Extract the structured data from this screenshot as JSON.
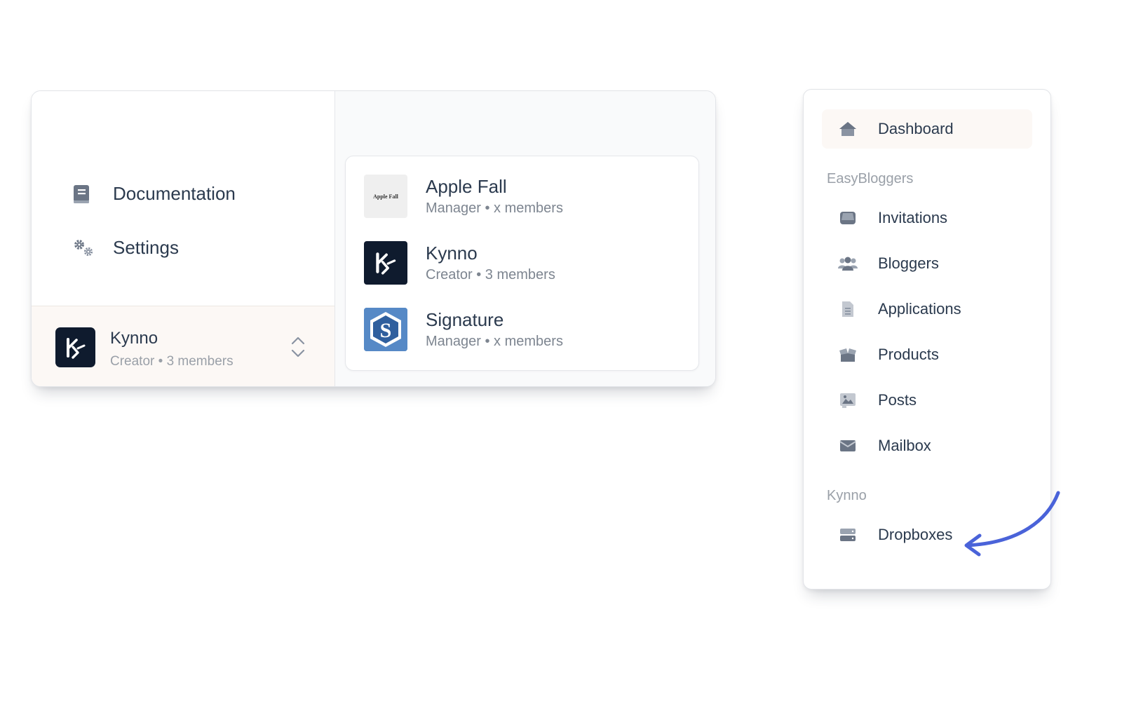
{
  "menu": {
    "documentation_label": "Documentation",
    "settings_label": "Settings"
  },
  "current_workspace": {
    "name": "Kynno",
    "subtitle": "Creator • 3 members"
  },
  "workspaces": [
    {
      "name": "Apple Fall",
      "subtitle": "Manager • x members",
      "logo_text": "Apple Fall"
    },
    {
      "name": "Kynno",
      "subtitle": "Creator • 3 members"
    },
    {
      "name": "Signature",
      "subtitle": "Manager • x members"
    }
  ],
  "nav": {
    "dashboard_label": "Dashboard",
    "section_easybloggers": "EasyBloggers",
    "items": [
      {
        "label": "Invitations",
        "icon": "inbox-icon"
      },
      {
        "label": "Bloggers",
        "icon": "users-icon"
      },
      {
        "label": "Applications",
        "icon": "document-icon"
      },
      {
        "label": "Products",
        "icon": "box-icon"
      },
      {
        "label": "Posts",
        "icon": "image-icon"
      },
      {
        "label": "Mailbox",
        "icon": "envelope-icon"
      }
    ],
    "section_kynno": "Kynno",
    "dropbox_label": "Dropboxes"
  },
  "colors": {
    "accent_arrow": "#4a63d9",
    "active_bg": "#fcf8f5",
    "icon_gray": "#6b7280",
    "logo_dark": "#0f1b2e"
  }
}
